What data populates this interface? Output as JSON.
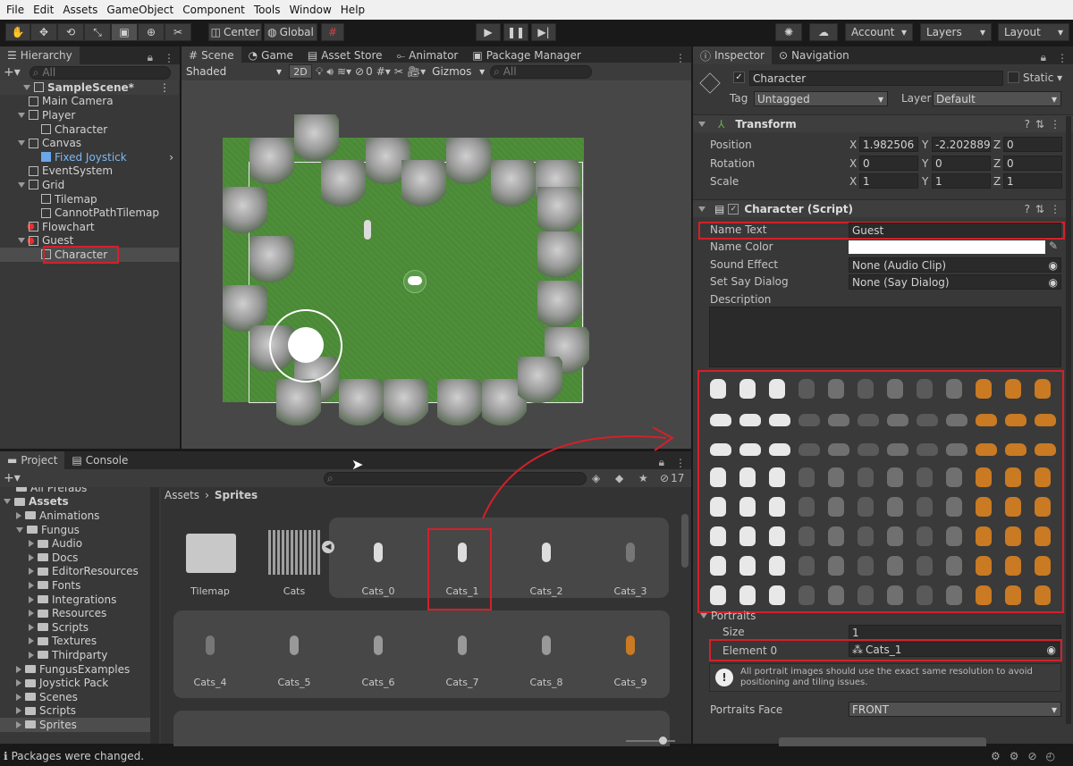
{
  "menu": [
    "File",
    "Edit",
    "Assets",
    "GameObject",
    "Component",
    "Tools",
    "Window",
    "Help"
  ],
  "toolbar": {
    "center": "Center",
    "global": "Global",
    "account": "Account",
    "layers": "Layers",
    "layout": "Layout"
  },
  "hierarchy": {
    "tab": "Hierarchy",
    "search": "All",
    "items": [
      {
        "label": "SampleScene*",
        "depth": 0,
        "type": "scene"
      },
      {
        "label": "Main Camera",
        "depth": 1
      },
      {
        "label": "Player",
        "depth": 1,
        "expanded": true
      },
      {
        "label": "Character",
        "depth": 2
      },
      {
        "label": "Canvas",
        "depth": 1,
        "expanded": true
      },
      {
        "label": "Fixed Joystick",
        "depth": 2,
        "prefab": true
      },
      {
        "label": "EventSystem",
        "depth": 1
      },
      {
        "label": "Grid",
        "depth": 1,
        "expanded": true
      },
      {
        "label": "Tilemap",
        "depth": 2
      },
      {
        "label": "CannotPathTilemap",
        "depth": 2
      },
      {
        "label": "Flowchart",
        "depth": 1,
        "mushroom": true
      },
      {
        "label": "Guest",
        "depth": 1,
        "mushroom": true,
        "expanded": true
      },
      {
        "label": "Character",
        "depth": 2,
        "selected": true
      }
    ]
  },
  "scene": {
    "tabs": [
      "Scene",
      "Game",
      "Asset Store",
      "Animator",
      "Package Manager"
    ],
    "shading": "Shaded",
    "mode2d": "2D",
    "hidden_count": "0",
    "gizmos": "Gizmos",
    "search": "All"
  },
  "inspector": {
    "tabs": [
      "Inspector",
      "Navigation"
    ],
    "object_name": "Character",
    "static_label": "Static",
    "tag_label": "Tag",
    "tag_value": "Untagged",
    "layer_label": "Layer",
    "layer_value": "Default",
    "transform": {
      "title": "Transform",
      "position_label": "Position",
      "rotation_label": "Rotation",
      "scale_label": "Scale",
      "position": [
        "1.982506",
        "-2.202889",
        "0"
      ],
      "rotation": [
        "0",
        "0",
        "0"
      ],
      "scale": [
        "1",
        "1",
        "1"
      ]
    },
    "script": {
      "title": "Character (Script)",
      "name_text_label": "Name Text",
      "name_text": "Guest",
      "name_color_label": "Name Color",
      "sound_label": "Sound Effect",
      "sound_value": "None (Audio Clip)",
      "say_label": "Set Say Dialog",
      "say_value": "None (Say Dialog)",
      "desc_label": "Description",
      "portraits_label": "Portraits",
      "size_label": "Size",
      "size_value": "1",
      "element_label": "Element 0",
      "element_value": "Cats_1",
      "help": "All portrait images should use the exact same resolution to avoid positioning and tiling issues.",
      "face_label": "Portraits Face",
      "face_value": "FRONT"
    }
  },
  "project": {
    "tabs": [
      "Project",
      "Console"
    ],
    "count": "17",
    "breadcrumb_root": "Assets",
    "breadcrumb_leaf": "Sprites",
    "tree": [
      {
        "label": "All Prefabs",
        "depth": 1
      },
      {
        "label": "Assets",
        "depth": 0,
        "bold": true
      },
      {
        "label": "Animations",
        "depth": 1
      },
      {
        "label": "Fungus",
        "depth": 1
      },
      {
        "label": "Audio",
        "depth": 2
      },
      {
        "label": "Docs",
        "depth": 2
      },
      {
        "label": "EditorResources",
        "depth": 2
      },
      {
        "label": "Fonts",
        "depth": 2
      },
      {
        "label": "Integrations",
        "depth": 2
      },
      {
        "label": "Resources",
        "depth": 2
      },
      {
        "label": "Scripts",
        "depth": 2
      },
      {
        "label": "Textures",
        "depth": 2
      },
      {
        "label": "Thirdparty",
        "depth": 2
      },
      {
        "label": "FungusExamples",
        "depth": 1
      },
      {
        "label": "Joystick Pack",
        "depth": 1
      },
      {
        "label": "Scenes",
        "depth": 1
      },
      {
        "label": "Scripts",
        "depth": 1
      },
      {
        "label": "Sprites",
        "depth": 1
      }
    ],
    "assets_row1": [
      "Tilemap",
      "Cats",
      "Cats_0",
      "Cats_1",
      "Cats_2",
      "Cats_3"
    ],
    "assets_row2": [
      "Cats_4",
      "Cats_5",
      "Cats_6",
      "Cats_7",
      "Cats_8",
      "Cats_9"
    ]
  },
  "status": "Packages were changed.",
  "colors": {
    "accent_red": "#d4202a",
    "grass": "#4a8a36",
    "selected": "#2c5d87"
  }
}
